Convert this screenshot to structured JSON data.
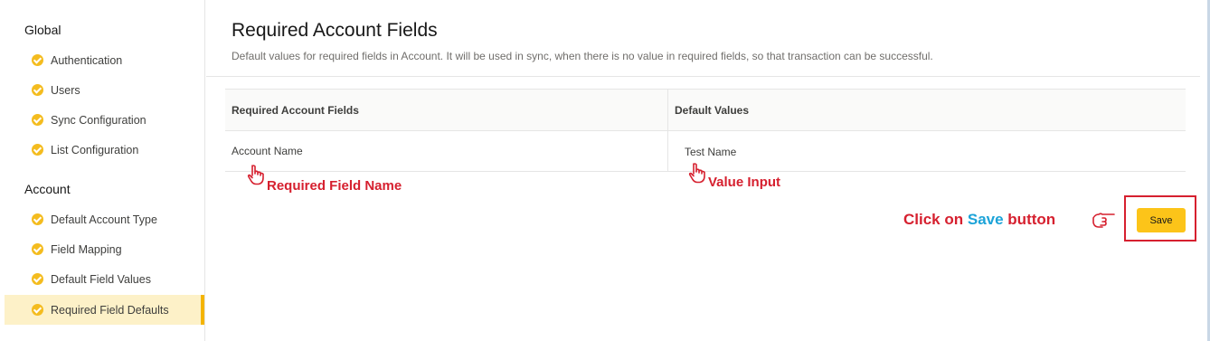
{
  "sidebar": {
    "sections": [
      {
        "title": "Global",
        "items": [
          {
            "label": "Authentication"
          },
          {
            "label": "Users"
          },
          {
            "label": "Sync Configuration"
          },
          {
            "label": "List Configuration"
          }
        ]
      },
      {
        "title": "Account",
        "items": [
          {
            "label": "Default Account Type"
          },
          {
            "label": "Field Mapping"
          },
          {
            "label": "Default Field Values"
          },
          {
            "label": "Required Field Defaults"
          }
        ]
      }
    ],
    "active_item": "Required Field Defaults",
    "icon": "check-circle-icon"
  },
  "main": {
    "title": "Required Account Fields",
    "description": "Default values for required fields in Account. It will be used in sync, when there is no value in required fields, so that transaction can be successful.",
    "table": {
      "headers": [
        "Required Account Fields",
        "Default Values"
      ],
      "rows": [
        {
          "field": "Account Name",
          "value": "Test Name"
        }
      ]
    },
    "save_label": "Save"
  },
  "annotations": {
    "field_name": "Required Field Name",
    "value_input": "Value Input",
    "click_prefix": "Click on",
    "click_highlight": "Save",
    "click_suffix": "button",
    "hand_icon": "pointing-hand-icon"
  },
  "colors": {
    "accent": "#f4bc1f",
    "active_bg": "#fdf1c8",
    "annotation_red": "#d6202f",
    "annotation_blue": "#1ca3d8"
  }
}
